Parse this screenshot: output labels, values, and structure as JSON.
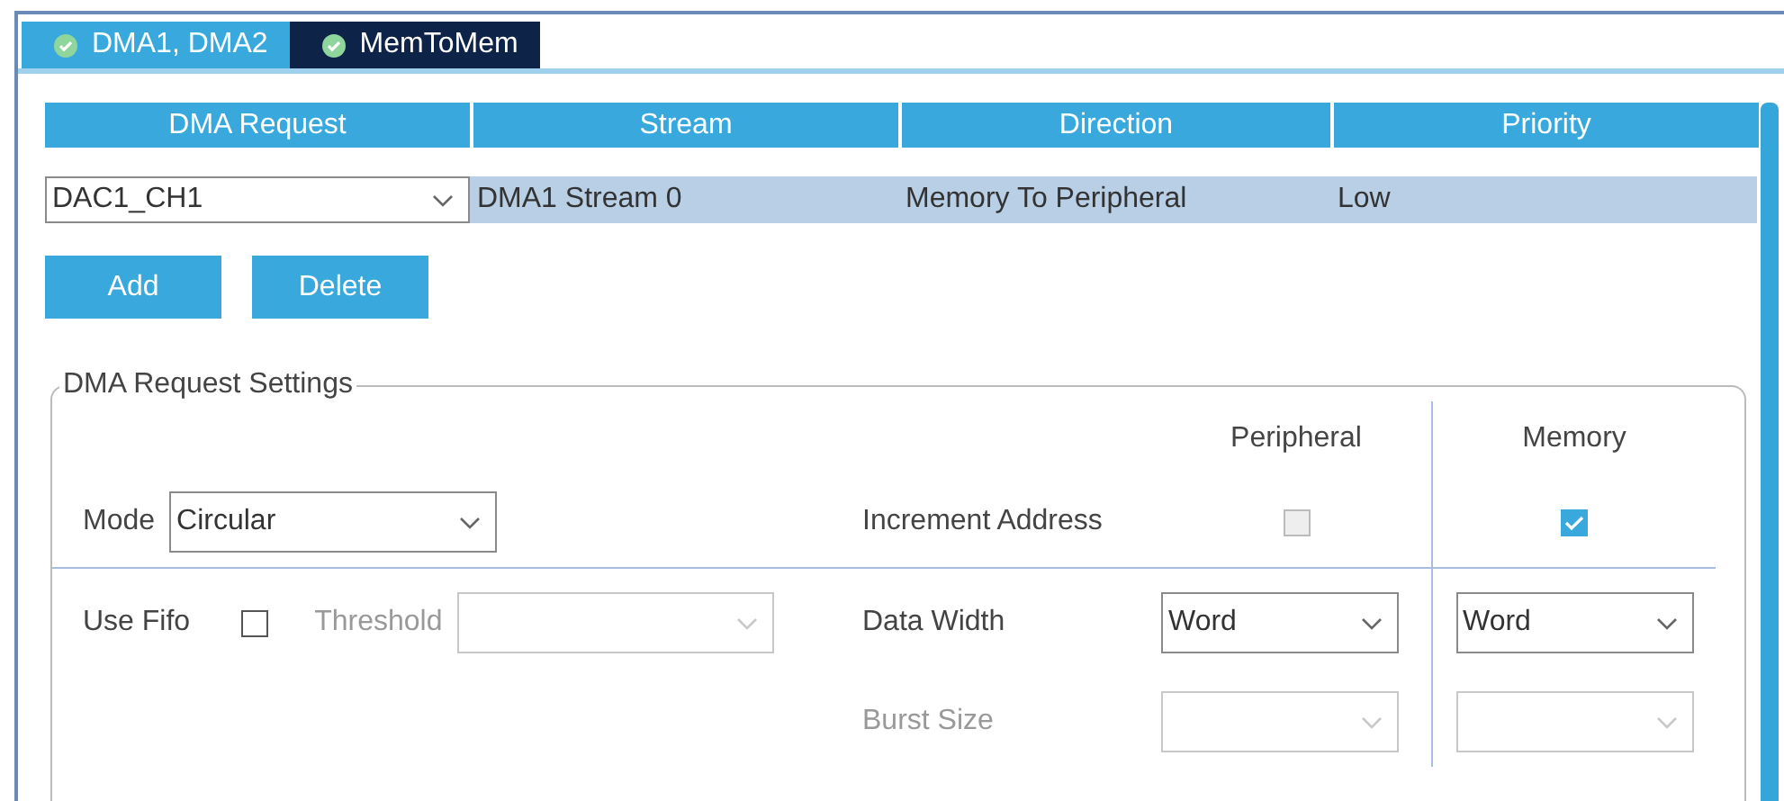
{
  "tabs": [
    {
      "label": "DMA1, DMA2",
      "selected": false
    },
    {
      "label": "MemToMem",
      "selected": true
    }
  ],
  "table": {
    "columns": [
      "DMA Request",
      "Stream",
      "Direction",
      "Priority"
    ],
    "rows": [
      {
        "request": "DAC1_CH1",
        "stream": "DMA1 Stream 0",
        "direction": "Memory To Peripheral",
        "priority": "Low",
        "selected": true
      }
    ]
  },
  "buttons": [
    "Add",
    "Delete"
  ],
  "settings": {
    "legend": "DMA Request Settings",
    "columns": [
      "Peripheral",
      "Memory"
    ],
    "mode": {
      "label": "Mode",
      "value": "Circular"
    },
    "increment_address": {
      "label": "Increment Address",
      "peripheral": {
        "checked": false,
        "disabled": true
      },
      "memory": {
        "checked": true
      }
    },
    "use_fifo": {
      "label": "Use Fifo",
      "checked": false
    },
    "threshold": {
      "label": "Threshold",
      "disabled": true
    },
    "data_width": {
      "label": "Data Width",
      "disabled": false,
      "peripheral": "Word",
      "memory": "Word"
    },
    "burst_size": {
      "label": "Burst Size",
      "disabled": true
    }
  }
}
